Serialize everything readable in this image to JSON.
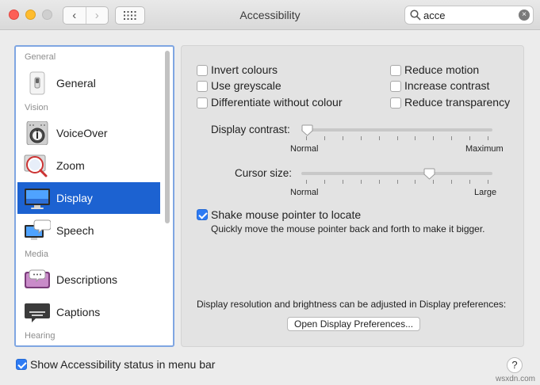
{
  "window": {
    "title": "Accessibility",
    "back_glyph": "‹",
    "forward_glyph": "›",
    "grid_icon": "grid-icon"
  },
  "search": {
    "value": "acce",
    "icon": "magnifier-icon",
    "clear_glyph": "×"
  },
  "sidebar": {
    "sections": {
      "general": "General",
      "vision": "Vision",
      "media": "Media",
      "hearing": "Hearing"
    },
    "items": [
      {
        "label": "General",
        "icon": "switch-icon"
      },
      {
        "label": "VoiceOver",
        "icon": "voiceover-icon"
      },
      {
        "label": "Zoom",
        "icon": "zoom-icon"
      },
      {
        "label": "Display",
        "icon": "display-icon",
        "selected": true
      },
      {
        "label": "Speech",
        "icon": "speech-icon"
      },
      {
        "label": "Descriptions",
        "icon": "descriptions-icon"
      },
      {
        "label": "Captions",
        "icon": "captions-icon"
      }
    ]
  },
  "display": {
    "checkboxes": [
      {
        "label": "Invert colours",
        "checked": false
      },
      {
        "label": "Use greyscale",
        "checked": false
      },
      {
        "label": "Differentiate without colour",
        "checked": false
      },
      {
        "label": "Reduce motion",
        "checked": false
      },
      {
        "label": "Increase contrast",
        "checked": false
      },
      {
        "label": "Reduce transparency",
        "checked": false
      }
    ],
    "contrast": {
      "label": "Display contrast:",
      "min": "Normal",
      "max": "Maximum",
      "value": 0
    },
    "cursor": {
      "label": "Cursor size:",
      "min": "Normal",
      "max": "Large",
      "value": 0.68
    },
    "shake": {
      "label": "Shake mouse pointer to locate",
      "checked": true,
      "hint": "Quickly move the mouse pointer back and forth to make it bigger."
    },
    "resolution_note": "Display resolution and brightness can be adjusted in Display preferences:",
    "open_button": "Open Display Preferences..."
  },
  "footer": {
    "status_label": "Show Accessibility status in menu bar",
    "status_checked": true,
    "help": "?"
  },
  "watermark": "wsxdn.com",
  "colors": {
    "accent": "#1c62d1",
    "checkbox_on": "#2d7bf4",
    "close": "#fd5f57",
    "minimize": "#febc2e"
  }
}
